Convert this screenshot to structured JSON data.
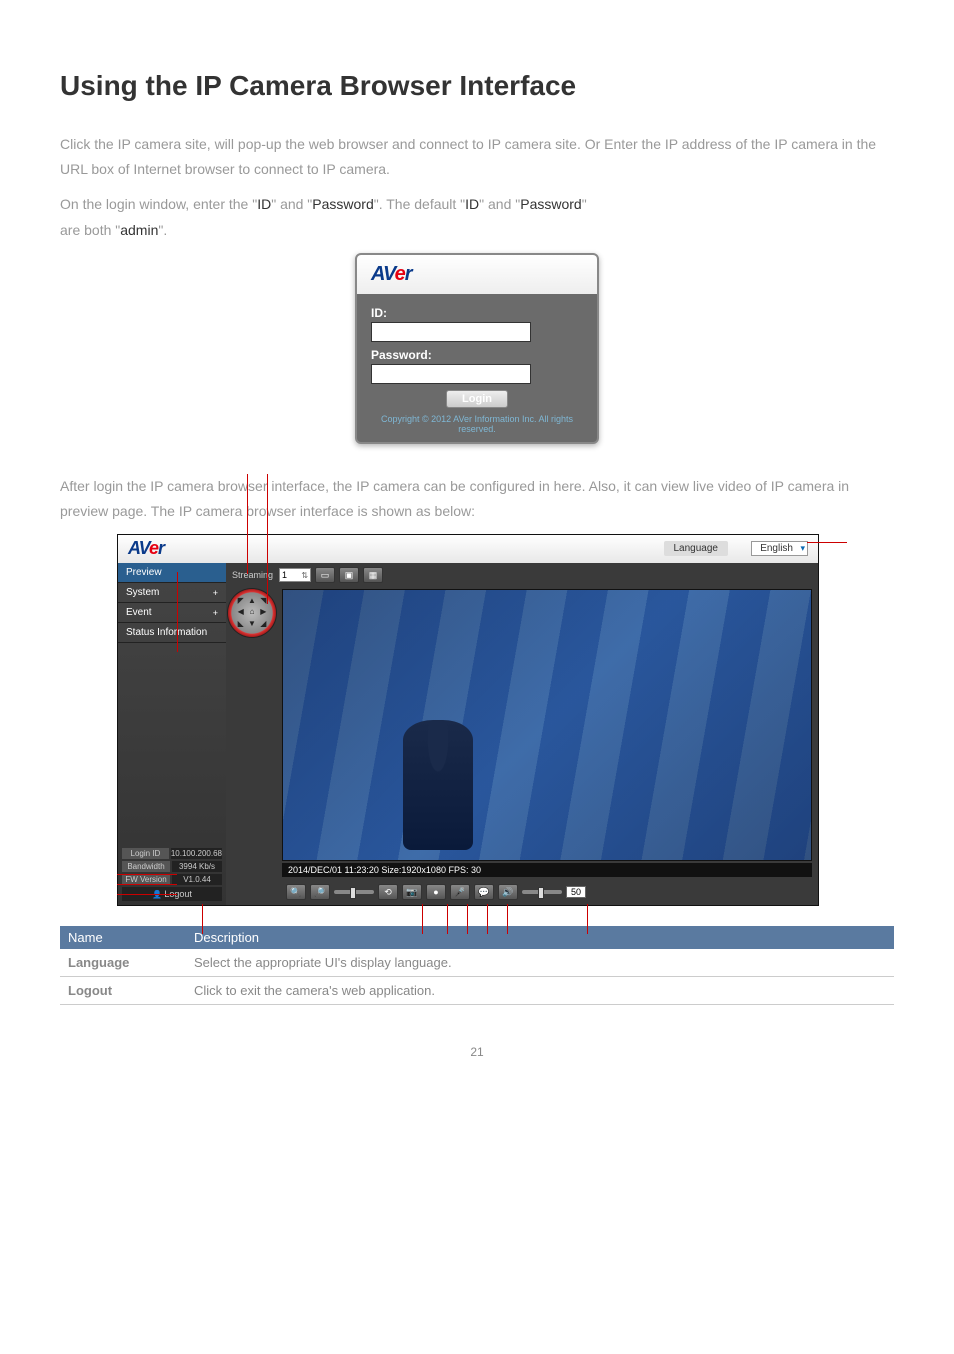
{
  "page": {
    "title": "Using the IP Camera Browser Interface",
    "intro1": "Click the IP camera site, will pop-up the web browser and connect to IP camera site. Or Enter the IP address of the IP camera in the URL box of Internet browser to connect to IP camera.",
    "intro2_a": "On the login window, enter the \"",
    "intro2_b": "ID",
    "intro2_c": "\" and \"",
    "intro2_d": "Password",
    "intro2_e": "\". The default \"",
    "intro2_f": "ID",
    "intro2_g": "\" and \"",
    "intro2_h": "Password",
    "intro2_i": "\"",
    "intro3_a": "are both \"",
    "intro3_b": "admin",
    "intro3_c": "\".",
    "after_login": "After login the IP camera browser interface, the IP camera can be configured in here. Also, it can view live video of IP camera in preview page. The IP camera browser interface is shown as below:",
    "page_number": "21"
  },
  "login_box": {
    "brand_a": "AV",
    "brand_b": "e",
    "brand_c": "r",
    "id_label": "ID:",
    "pw_label": "Password:",
    "login_btn": "Login",
    "copyright": "Copyright © 2012 AVer Information Inc. All rights reserved."
  },
  "ui": {
    "brand_a": "AV",
    "brand_b": "e",
    "brand_c": "r",
    "language_label": "Language",
    "language_value": "English",
    "nav": {
      "preview": "Preview",
      "system": "System",
      "event": "Event",
      "status": "Status Information"
    },
    "sb": {
      "login_id_k": "Login ID",
      "login_id_v": "10.100.200.68",
      "bw_k": "Bandwidth",
      "bw_v": "3994 Kb/s",
      "fw_k": "FW Version",
      "fw_v": "V1.0.44",
      "logout": "Logout"
    },
    "stream_label": "Streaming",
    "stream_val": "1",
    "video_info": "2014/DEC/01 11:23:20 Size:1920x1080 FPS: 30",
    "vol_val": "50"
  },
  "table": {
    "h1": "Name",
    "h2": "Description",
    "r1_k": "Language",
    "r1_v": "Select the appropriate UI's display language.",
    "r2_k": "Logout",
    "r2_v": "Click to exit the camera's web application."
  }
}
